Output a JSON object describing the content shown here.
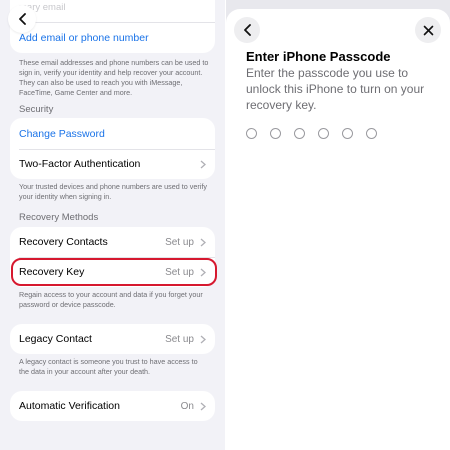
{
  "left": {
    "faded_text": "mary email",
    "add_email": "Add email or phone number",
    "email_note": "These email addresses and phone numbers can be used to sign in, verify your identity and help recover your account. They can also be used to reach you with iMessage, FaceTime, Game Center and more.",
    "security_header": "Security",
    "change_password": "Change Password",
    "two_factor": "Two-Factor Authentication",
    "security_note": "Your trusted devices and phone numbers are used to verify your identity when signing in.",
    "recovery_header": "Recovery Methods",
    "recovery_contacts": {
      "label": "Recovery Contacts",
      "value": "Set up"
    },
    "recovery_key": {
      "label": "Recovery Key",
      "value": "Set up"
    },
    "recovery_note": "Regain access to your account and data if you forget your password or device passcode.",
    "legacy_contact": {
      "label": "Legacy Contact",
      "value": "Set up"
    },
    "legacy_note": "A legacy contact is someone you trust to have access to the data in your account after your death.",
    "automatic_verification": {
      "label": "Automatic Verification",
      "value": "On"
    }
  },
  "right": {
    "title": "Enter iPhone Passcode",
    "subtitle": "Enter the passcode you use to unlock this iPhone to turn on your recovery key.",
    "passcode_digits": 6
  },
  "colors": {
    "accent": "#1a73e8",
    "highlight": "#d6182f",
    "background": "#f2f2f7"
  }
}
